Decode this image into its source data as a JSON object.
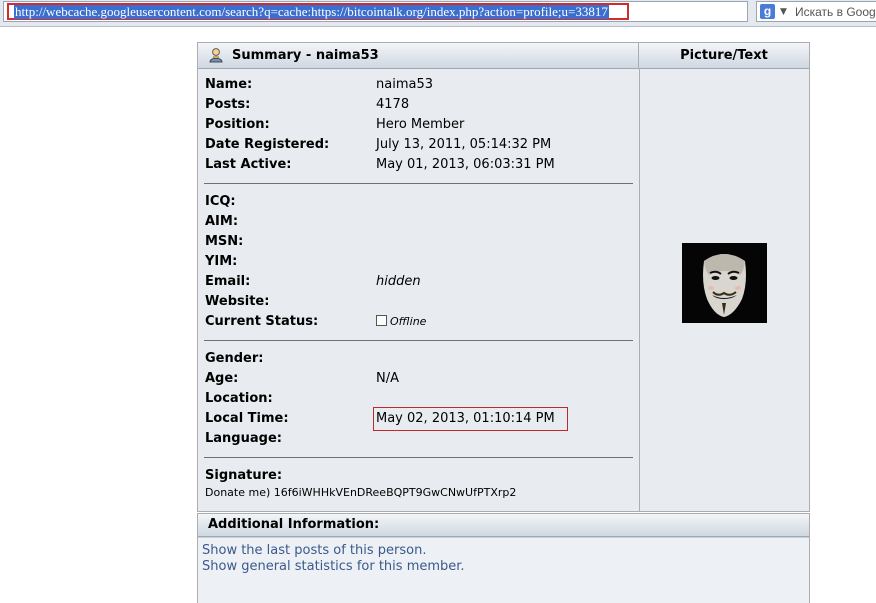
{
  "browser": {
    "url": "http://webcache.googleusercontent.com/search?q=cache:https://bitcointalk.org/index.php?action=profile;u=33817",
    "search_logo": "g",
    "search_placeholder": "Искать в Goog"
  },
  "summary": {
    "title": "Summary - naima53",
    "picture_header": "Picture/Text",
    "fields": {
      "name": {
        "label": "Name:",
        "value": "naima53"
      },
      "posts": {
        "label": "Posts:",
        "value": "4178"
      },
      "position": {
        "label": "Position:",
        "value": "Hero Member"
      },
      "date_registered": {
        "label": "Date Registered:",
        "value": "July 13, 2011, 05:14:32 PM"
      },
      "last_active": {
        "label": "Last Active:",
        "value": "May 01, 2013, 06:03:31 PM"
      },
      "icq": {
        "label": "ICQ:",
        "value": ""
      },
      "aim": {
        "label": "AIM:",
        "value": ""
      },
      "msn": {
        "label": "MSN:",
        "value": ""
      },
      "yim": {
        "label": "YIM:",
        "value": ""
      },
      "email": {
        "label": "Email:",
        "value": "hidden"
      },
      "website": {
        "label": "Website:",
        "value": ""
      },
      "current_status": {
        "label": "Current Status:",
        "value": "Offline"
      },
      "gender": {
        "label": "Gender:",
        "value": ""
      },
      "age": {
        "label": "Age:",
        "value": "N/A"
      },
      "location": {
        "label": "Location:",
        "value": ""
      },
      "local_time": {
        "label": "Local Time:",
        "value": "May 02, 2013, 01:10:14 PM"
      },
      "language": {
        "label": "Language:",
        "value": ""
      },
      "signature": {
        "label": "Signature:",
        "value": "Donate me) 16f6iWHHkVEnDReeBQPT9GwCNwUfPTXrp2"
      }
    }
  },
  "additional": {
    "title": "Additional Information:",
    "links": [
      "Show the last posts of this person.",
      "Show general statistics for this member."
    ]
  },
  "colors": {
    "highlight": "#d12b2b",
    "link": "#3a5a8c",
    "panel_bg": "#e8ecf0"
  }
}
